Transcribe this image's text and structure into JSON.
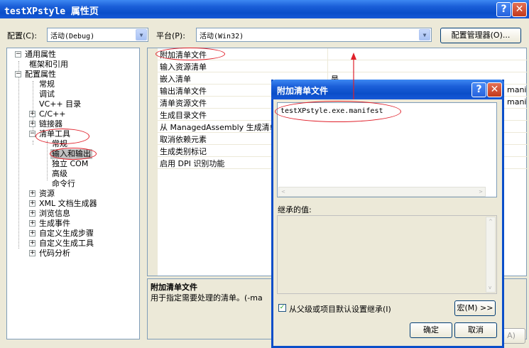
{
  "window": {
    "title": "testXPstyle 属性页",
    "help_glyph": "?",
    "close_glyph": "✕"
  },
  "toolbar": {
    "config_label": "配置(C):",
    "config_value": "活动(Debug)",
    "platform_label": "平台(P):",
    "platform_value": "活动(Win32)",
    "config_manager_label": "配置管理器(O)..."
  },
  "tree": {
    "items": [
      {
        "label": "通用属性",
        "expander": "−"
      },
      {
        "label": "框架和引用"
      },
      {
        "label": "配置属性",
        "expander": "−"
      },
      {
        "label": "常规"
      },
      {
        "label": "调试"
      },
      {
        "label": "VC++ 目录"
      },
      {
        "label": "C/C++",
        "expander": "+"
      },
      {
        "label": "链接器",
        "expander": "+"
      },
      {
        "label": "清单工具",
        "expander": "−"
      },
      {
        "label": "常规"
      },
      {
        "label": "输入和输出"
      },
      {
        "label": "独立 COM"
      },
      {
        "label": "高级"
      },
      {
        "label": "命令行"
      },
      {
        "label": "资源",
        "expander": "+"
      },
      {
        "label": "XML 文档生成器",
        "expander": "+"
      },
      {
        "label": "浏览信息",
        "expander": "+"
      },
      {
        "label": "生成事件",
        "expander": "+"
      },
      {
        "label": "自定义生成步骤",
        "expander": "+"
      },
      {
        "label": "自定义生成工具",
        "expander": "+"
      },
      {
        "label": "代码分析",
        "expander": "+"
      }
    ]
  },
  "grid": {
    "rows": [
      {
        "name": "附加清单文件",
        "value": ""
      },
      {
        "name": "输入资源清单",
        "value": ""
      },
      {
        "name": "嵌入清单",
        "value": "是"
      },
      {
        "name": "输出清单文件",
        "value": "mani"
      },
      {
        "name": "清单资源文件",
        "value": "mani"
      },
      {
        "name": "生成目录文件",
        "value": ""
      },
      {
        "name": "从 ManagedAssembly 生成清单",
        "value": ""
      },
      {
        "name": "取消依赖元素",
        "value": ""
      },
      {
        "name": "生成类别标记",
        "value": ""
      },
      {
        "name": "启用 DPI 识别功能",
        "value": ""
      }
    ]
  },
  "description": {
    "title": "附加清单文件",
    "text": "用于指定需要处理的清单。(-ma"
  },
  "dialog": {
    "title": "附加清单文件",
    "help_glyph": "?",
    "close_glyph": "✕",
    "value": "testXPstyle.exe.manifest",
    "inherited_label": "继承的值:",
    "inherit_checkbox_label": "从父级或项目默认设置继承(I)",
    "inherit_checked": true,
    "macro_button": "宏(M) >>",
    "ok_button": "确定",
    "cancel_button": "取消"
  },
  "background_button": {
    "label": "A)"
  },
  "colors": {
    "titlebar": "#0a4ec9",
    "annotation": "#e0202a",
    "window_bg": "#ece9d8"
  }
}
